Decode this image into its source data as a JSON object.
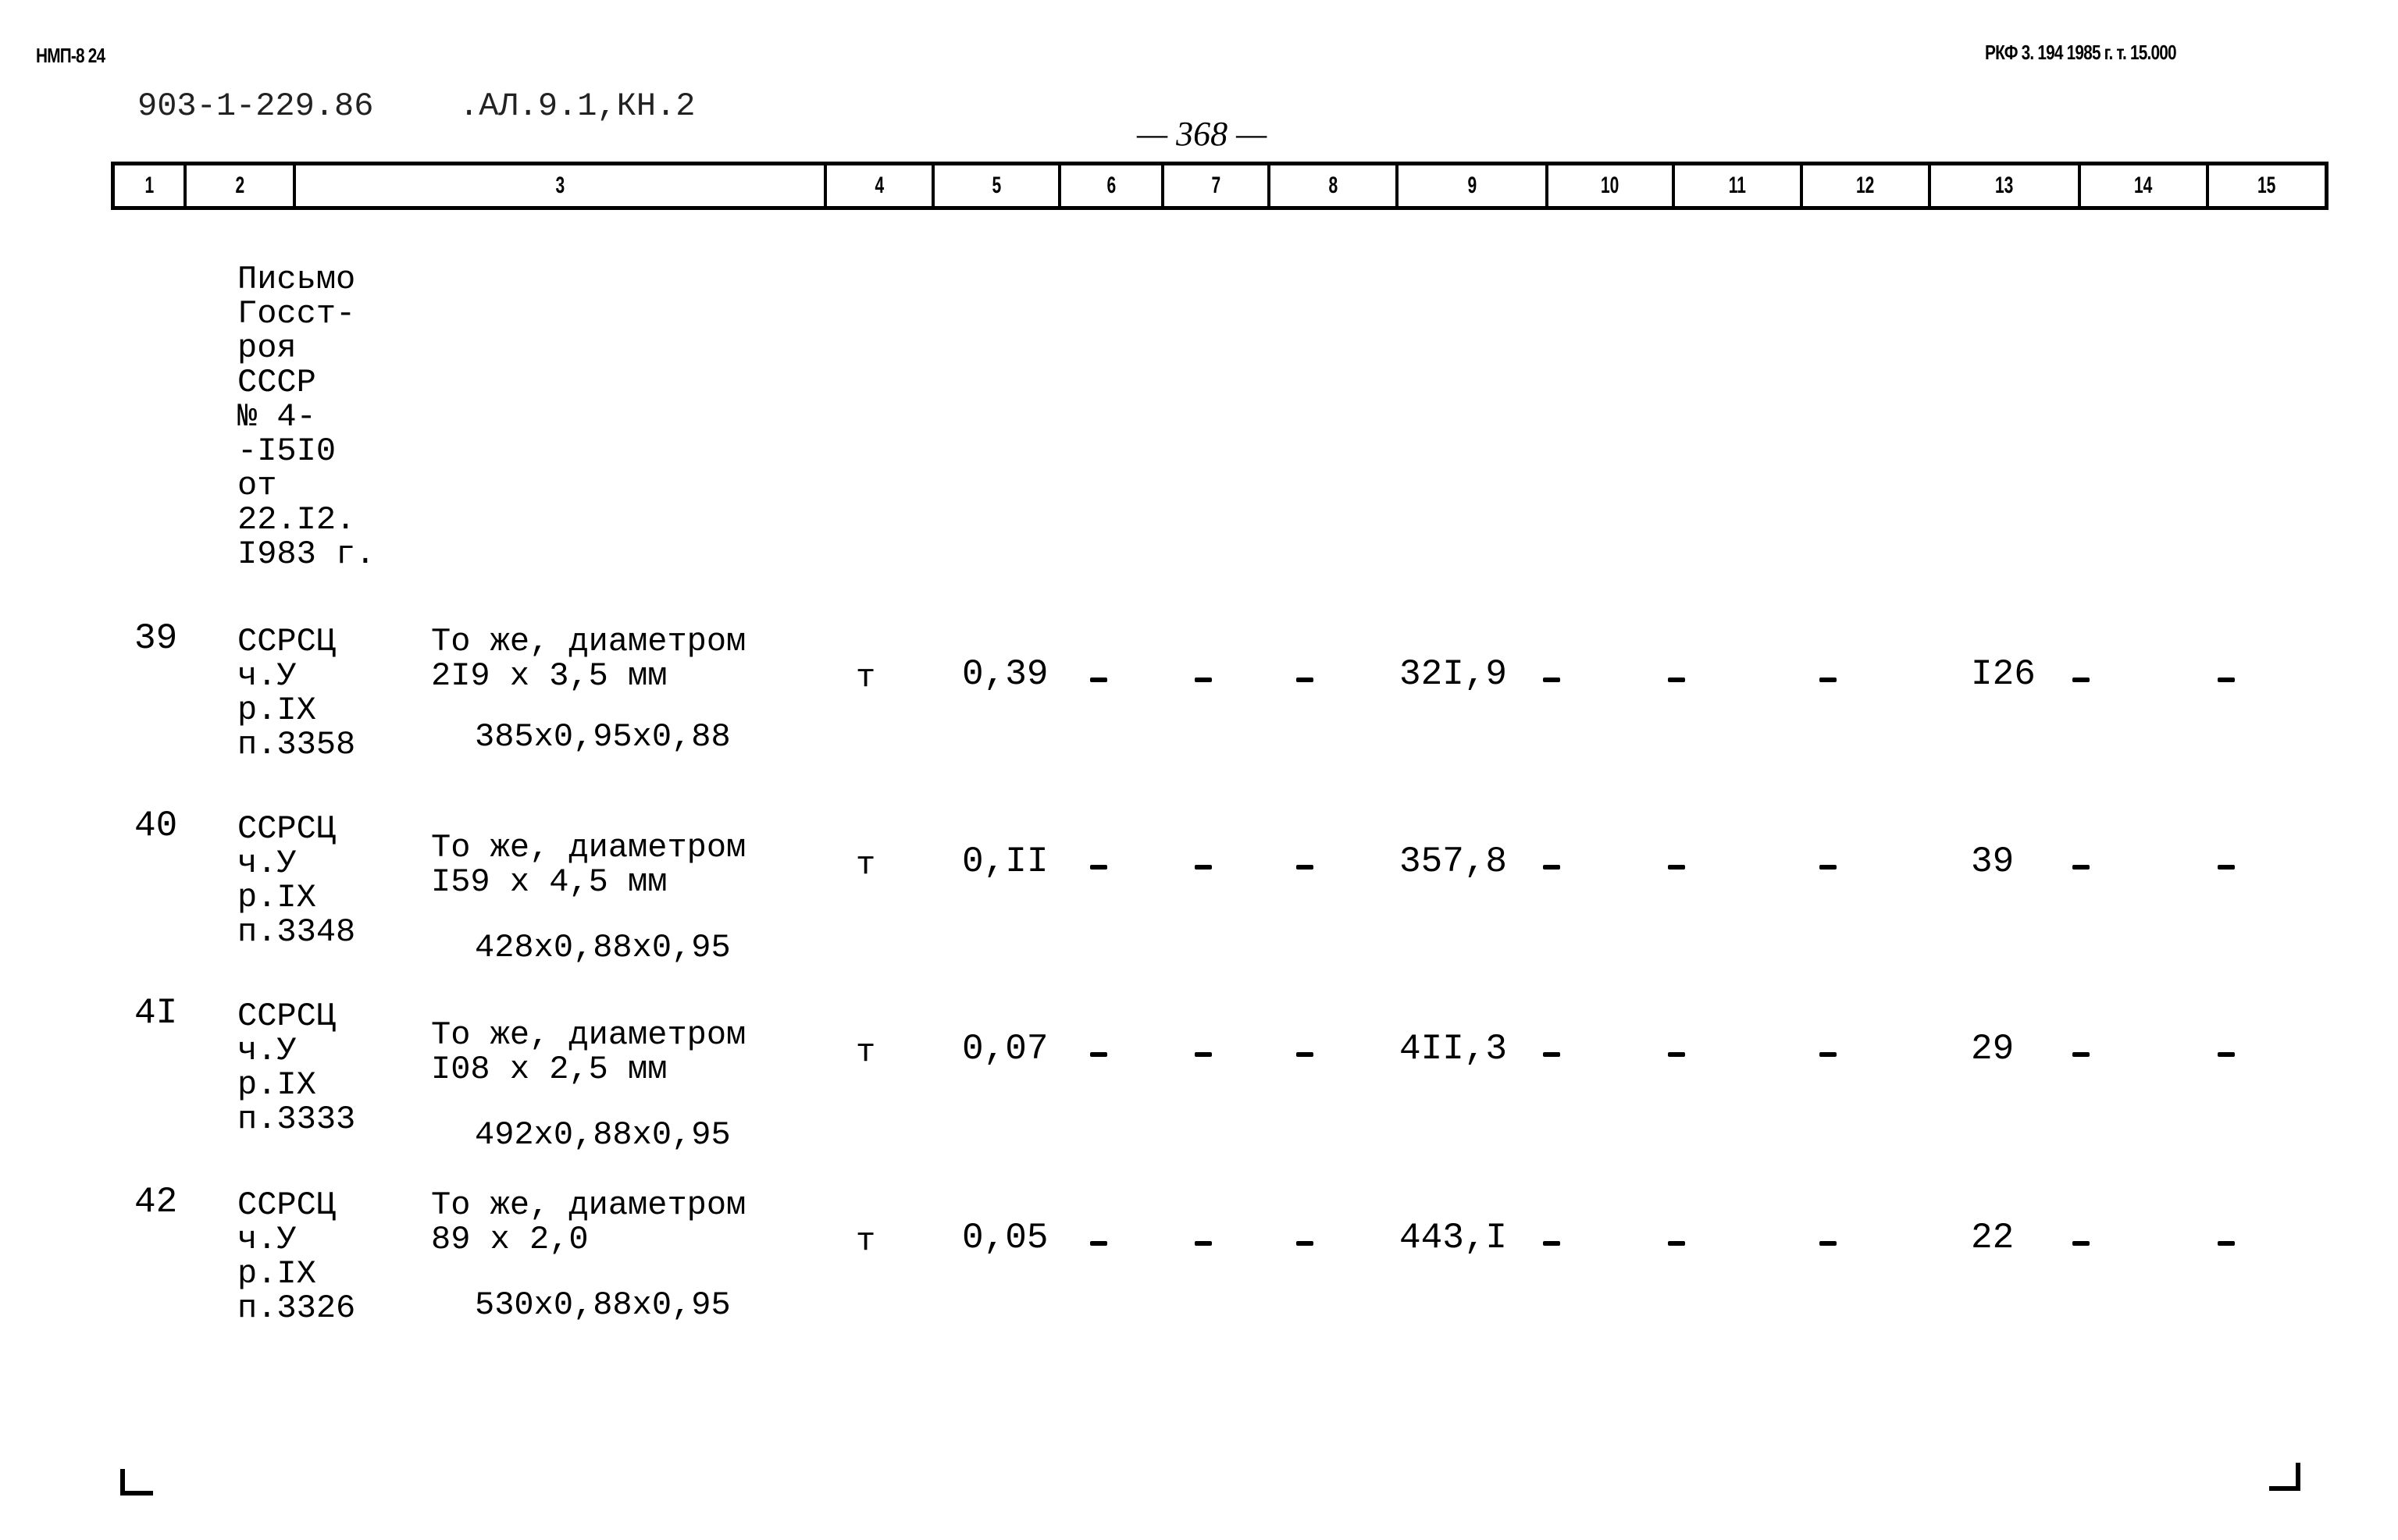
{
  "header": {
    "left_code": "НМП-8 24",
    "right_code": "РКФ 3. 194 1985 г. т. 15.000",
    "doc_ref": "903-1-229.86",
    "album_ref": ".АЛ.9.1,КН.2",
    "page_number": "— 368 —"
  },
  "column_numbers": [
    "1",
    "2",
    "3",
    "4",
    "5",
    "6",
    "7",
    "8",
    "9",
    "10",
    "11",
    "12",
    "13",
    "14",
    "15"
  ],
  "note_block": {
    "lines": [
      "Письмо",
      "Госст-",
      "роя",
      "СССР",
      "№ 4-",
      "-I5I0",
      "от",
      "22.I2.",
      "I983 г."
    ]
  },
  "rows": [
    {
      "num": "39",
      "code_lines": [
        "ССРСЦ",
        "ч.У",
        "р.IX",
        "п.3358"
      ],
      "desc_lines": [
        "То же, диаметром",
        "2I9 x 3,5 мм"
      ],
      "formula": "385x0,95x0,88",
      "unit": "т",
      "col5": "0,39",
      "col6": "-",
      "col7": "-",
      "col8": "-",
      "col9": "32I,9",
      "col10": "-",
      "col11": "-",
      "col12": "-",
      "col13": "I26",
      "col14": "-",
      "col15": "-"
    },
    {
      "num": "40",
      "code_lines": [
        "ССРСЦ",
        "ч.У",
        "р.IX",
        "п.3348"
      ],
      "desc_lines": [
        "То же, диаметром",
        "I59 x 4,5 мм"
      ],
      "formula": "428x0,88x0,95",
      "unit": "т",
      "col5": "0,II",
      "col6": "-",
      "col7": "-",
      "col8": "-",
      "col9": "357,8",
      "col10": "-",
      "col11": "-",
      "col12": "-",
      "col13": "39",
      "col14": "-",
      "col15": "-"
    },
    {
      "num": "4I",
      "code_lines": [
        "ССРСЦ",
        "ч.У",
        "р.IX",
        "п.3333"
      ],
      "desc_lines": [
        "То же, диаметром",
        "I08 x 2,5 мм"
      ],
      "formula": "492x0,88x0,95",
      "unit": "т",
      "col5": "0,07",
      "col6": "-",
      "col7": "-",
      "col8": "-",
      "col9": "4II,3",
      "col10": "-",
      "col11": "-",
      "col12": "-",
      "col13": "29",
      "col14": "-",
      "col15": "-"
    },
    {
      "num": "42",
      "code_lines": [
        "ССРСЦ",
        "ч.У",
        "р.IX",
        "п.3326"
      ],
      "desc_lines": [
        "То же, диаметром",
        "89 x 2,0"
      ],
      "formula": "530x0,88x0,95",
      "unit": "т",
      "col5": "0,05",
      "col6": "-",
      "col7": "-",
      "col8": "-",
      "col9": "443,I",
      "col10": "-",
      "col11": "-",
      "col12": "-",
      "col13": "22",
      "col14": "-",
      "col15": "-"
    }
  ]
}
